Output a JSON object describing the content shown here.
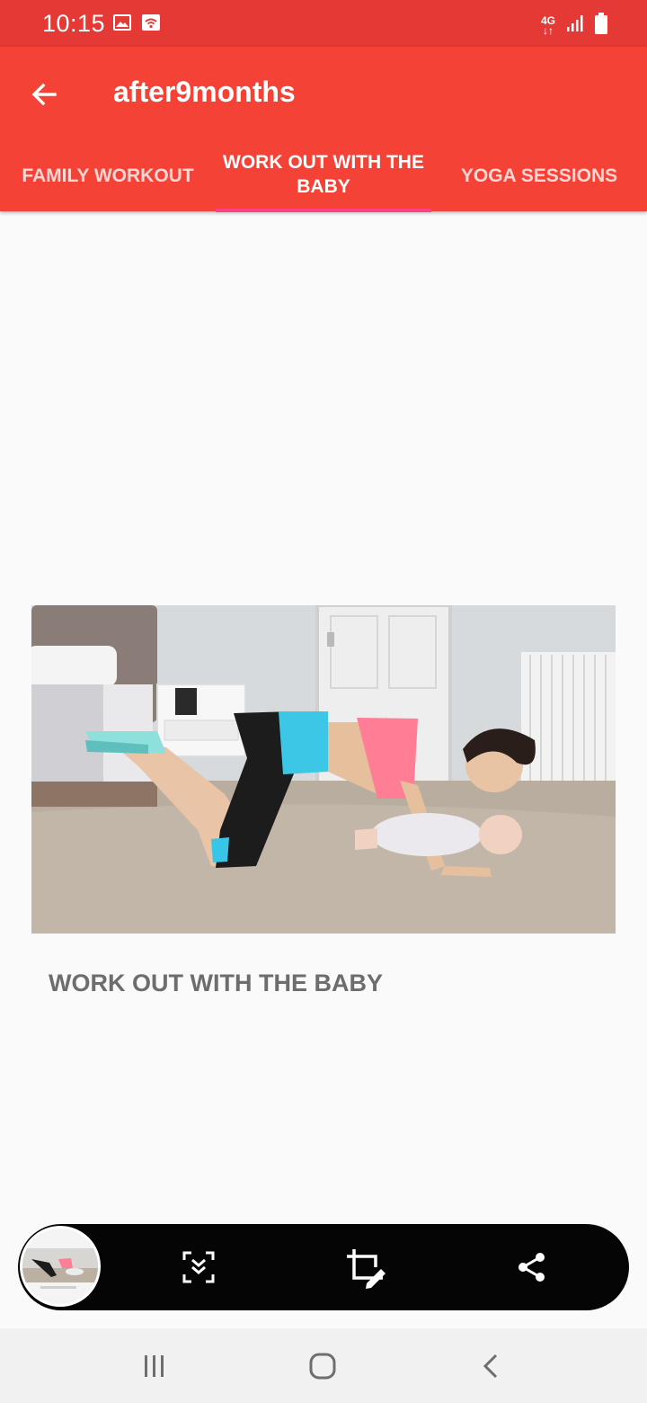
{
  "status_bar": {
    "time": "10:15",
    "network": "4G",
    "icons": [
      "image-notification-icon",
      "wifi-notification-icon",
      "signal-icon",
      "battery-icon"
    ]
  },
  "app_bar": {
    "title": "after9months",
    "back_icon": "arrow-left-icon",
    "background_color": "#f44336"
  },
  "tabs": [
    {
      "label": "FAMILY WORKOUT",
      "selected": false
    },
    {
      "label": "WORK OUT WITH THE BABY",
      "selected": true
    },
    {
      "label": "YOGA SESSIONS",
      "selected": false
    }
  ],
  "tab_indicator_color": "#ff4081",
  "content": {
    "video_caption": "WORK OUT WITH THE BABY",
    "thumbnail": "mother-doing-push-ups-over-baby-image"
  },
  "screenshot_toolbar": {
    "buttons": [
      "scroll-capture-icon",
      "crop-edit-icon",
      "share-icon"
    ]
  },
  "nav_bar": {
    "buttons": [
      "recents-icon",
      "home-icon",
      "back-icon"
    ]
  }
}
